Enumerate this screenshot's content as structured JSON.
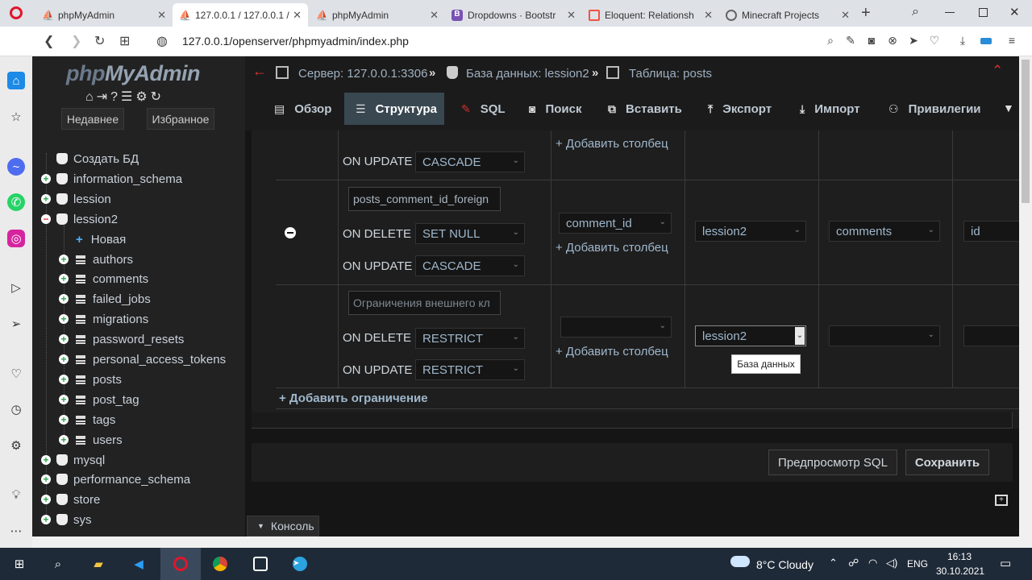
{
  "browser": {
    "tabs": [
      {
        "title": "phpMyAdmin",
        "active": false
      },
      {
        "title": "127.0.0.1 / 127.0.0.1 /",
        "active": true
      },
      {
        "title": "phpMyAdmin",
        "active": false
      },
      {
        "title": "Dropdowns · Bootstr",
        "active": false
      },
      {
        "title": "Eloquent: Relationsh",
        "active": false
      },
      {
        "title": "Minecraft Projects",
        "active": false
      }
    ],
    "new_tab": "+",
    "url": "127.0.0.1/openserver/phpmyadmin/index.php"
  },
  "nav": {
    "logo_php": "php",
    "logo_my": "MyAdmin",
    "recent": "Недавнее",
    "favorites": "Избранное",
    "tree": [
      {
        "label": "Создать БД",
        "kind": "db",
        "expander": "none",
        "indent": 0
      },
      {
        "label": "information_schema",
        "kind": "db",
        "expander": "plus",
        "indent": 0
      },
      {
        "label": "lession",
        "kind": "db",
        "expander": "plus",
        "indent": 0
      },
      {
        "label": "lession2",
        "kind": "db",
        "expander": "minus",
        "indent": 0
      },
      {
        "label": "Новая",
        "kind": "new",
        "expander": "none",
        "indent": 1
      },
      {
        "label": "authors",
        "kind": "table",
        "expander": "plus",
        "indent": 1
      },
      {
        "label": "comments",
        "kind": "table",
        "expander": "plus",
        "indent": 1
      },
      {
        "label": "failed_jobs",
        "kind": "table",
        "expander": "plus",
        "indent": 1
      },
      {
        "label": "migrations",
        "kind": "table",
        "expander": "plus",
        "indent": 1
      },
      {
        "label": "password_resets",
        "kind": "table",
        "expander": "plus",
        "indent": 1
      },
      {
        "label": "personal_access_tokens",
        "kind": "table",
        "expander": "plus",
        "indent": 1
      },
      {
        "label": "posts",
        "kind": "table",
        "expander": "plus",
        "indent": 1
      },
      {
        "label": "post_tag",
        "kind": "table",
        "expander": "plus",
        "indent": 1
      },
      {
        "label": "tags",
        "kind": "table",
        "expander": "plus",
        "indent": 1
      },
      {
        "label": "users",
        "kind": "table",
        "expander": "plus",
        "indent": 1
      },
      {
        "label": "mysql",
        "kind": "db",
        "expander": "plus",
        "indent": 0
      },
      {
        "label": "performance_schema",
        "kind": "db",
        "expander": "plus",
        "indent": 0
      },
      {
        "label": "store",
        "kind": "db",
        "expander": "plus",
        "indent": 0
      },
      {
        "label": "sys",
        "kind": "db",
        "expander": "plus",
        "indent": 0
      }
    ]
  },
  "breadcrumb": {
    "server": "Сервер: 127.0.0.1:3306",
    "database": "База данных: lession2",
    "table": "Таблица: posts",
    "sep": "»"
  },
  "menu": [
    {
      "label": "Обзор",
      "icon": "browse-icon",
      "active": false
    },
    {
      "label": "Структура",
      "icon": "structure-icon",
      "active": true
    },
    {
      "label": "SQL",
      "icon": "sql-icon",
      "active": false
    },
    {
      "label": "Поиск",
      "icon": "search-icon",
      "active": false
    },
    {
      "label": "Вставить",
      "icon": "insert-icon",
      "active": false
    },
    {
      "label": "Экспорт",
      "icon": "export-icon",
      "active": false
    },
    {
      "label": "Импорт",
      "icon": "import-icon",
      "active": false
    },
    {
      "label": "Привилегии",
      "icon": "privileges-icon",
      "active": false
    }
  ],
  "constraints": {
    "on_update_label": "ON UPDATE",
    "on_delete_label": "ON DELETE",
    "add_column": "+ Добавить столбец",
    "add_constraint": "+ Добавить ограничение",
    "row0": {
      "on_update": "CASCADE"
    },
    "row1": {
      "name": "posts_comment_id_foreign",
      "on_delete": "SET NULL",
      "on_update": "CASCADE",
      "column": "comment_id",
      "database": "lession2",
      "table": "comments",
      "ref_column": "id"
    },
    "row2": {
      "name_placeholder": "Ограничения внешнего кл",
      "on_delete": "RESTRICT",
      "on_update": "RESTRICT",
      "column": "",
      "database": "lession2",
      "table": "",
      "ref_column": ""
    },
    "tooltip": "База данных"
  },
  "actions": {
    "preview_sql": "Предпросмотр SQL",
    "save": "Сохранить"
  },
  "console_label": "Консоль",
  "taskbar": {
    "weather": "8°C  Cloudy",
    "lang": "ENG",
    "time": "16:13",
    "date": "30.10.2021"
  }
}
